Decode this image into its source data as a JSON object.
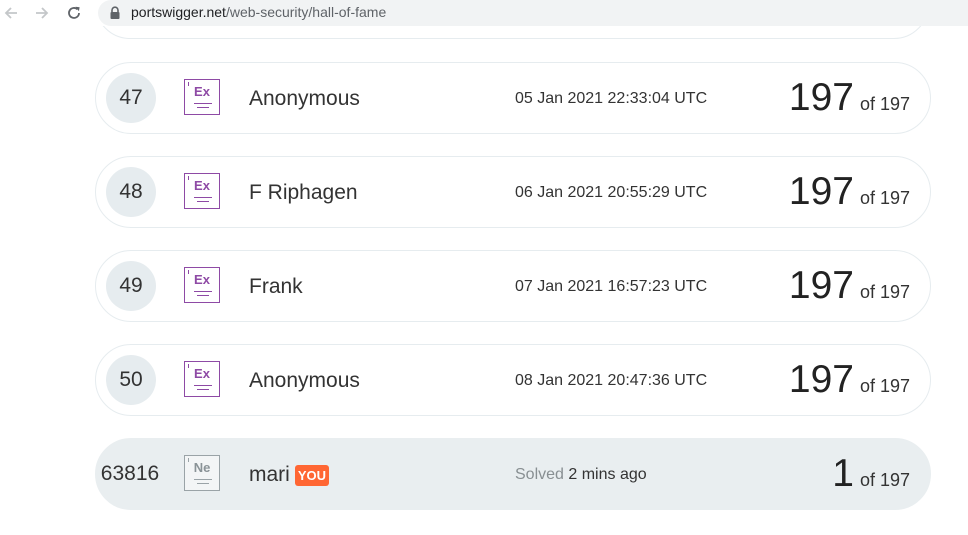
{
  "browser": {
    "url_host": "portswigger.net",
    "url_path": "/web-security/hall-of-fame"
  },
  "rows": [
    {
      "rank": "47",
      "badge": "Ex",
      "name": "Anonymous",
      "date": "05 Jan 2021 22:33:04 UTC",
      "score": "197",
      "of": "of 197"
    },
    {
      "rank": "48",
      "badge": "Ex",
      "name": "F Riphagen",
      "date": "06 Jan 2021 20:55:29 UTC",
      "score": "197",
      "of": "of 197"
    },
    {
      "rank": "49",
      "badge": "Ex",
      "name": "Frank",
      "date": "07 Jan 2021 16:57:23 UTC",
      "score": "197",
      "of": "of 197"
    },
    {
      "rank": "50",
      "badge": "Ex",
      "name": "Anonymous",
      "date": "08 Jan 2021 20:47:36 UTC",
      "score": "197",
      "of": "of 197"
    }
  ],
  "you_row": {
    "rank": "63816",
    "badge": "Ne",
    "name": "mari",
    "you_tag": "YOU",
    "solved_label": "Solved",
    "solved_when": "2 mins ago",
    "score": "1",
    "of": "of 197"
  },
  "colors": {
    "expert_badge": "#8e4aa5",
    "you_tag": "#ff6633",
    "you_row_bg": "#e9eef0"
  },
  "icons": {
    "back": "arrow-left-icon",
    "forward": "arrow-right-icon",
    "reload": "reload-icon",
    "lock": "lock-icon"
  }
}
